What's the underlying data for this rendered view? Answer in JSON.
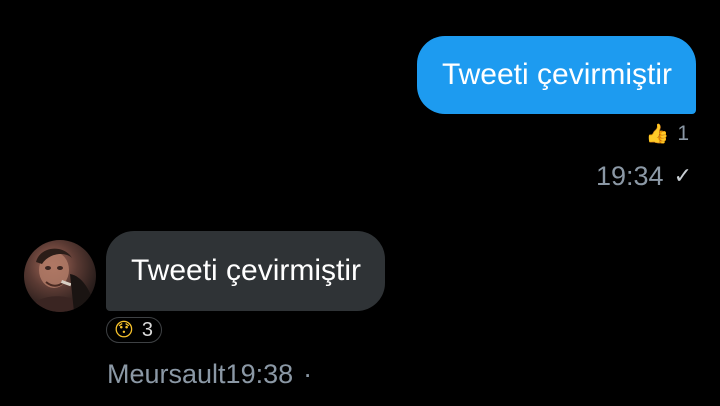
{
  "colors": {
    "background": "#000000",
    "outgoing_bubble": "#1d9bf0",
    "incoming_bubble": "#2f3336",
    "meta_text": "#8b98a5"
  },
  "messages": {
    "outgoing": {
      "text": "Tweeti çevirmiştir",
      "reaction": {
        "emoji_icon": "thumbs-up-icon",
        "emoji": "👍",
        "count": "1"
      },
      "time": "19:34",
      "status_icon": "checkmark-icon",
      "status_glyph": "✓"
    },
    "incoming": {
      "avatar_icon": "avatar",
      "text": "Tweeti çevirmiştir",
      "reaction": {
        "emoji_icon": "surprised-face-icon",
        "emoji": "😯",
        "count": "3"
      },
      "sender": "Meursault",
      "time": "19:38",
      "separator": "·"
    }
  }
}
